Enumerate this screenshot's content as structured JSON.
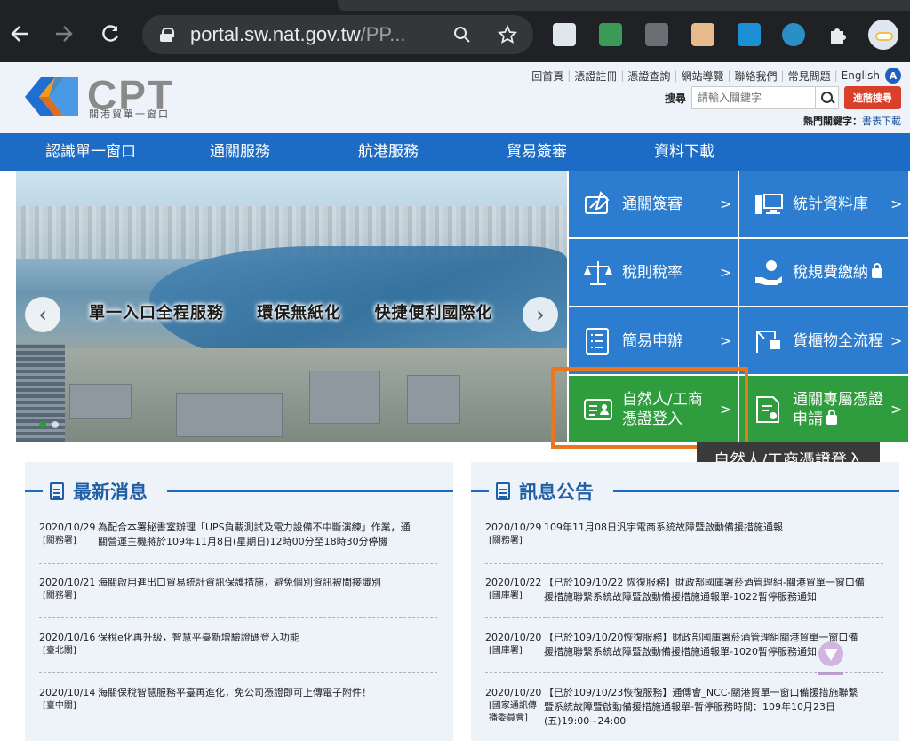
{
  "browser": {
    "url_main": "portal.sw.nat.gov.tw",
    "url_rest": "/PP..."
  },
  "header": {
    "logo_text": "CPT",
    "logo_sub": "關港貿單一窗口",
    "top_links": [
      "回首頁",
      "憑證註冊",
      "憑證查詢",
      "網站導覽",
      "聯絡我們",
      "常見問題",
      "English"
    ],
    "a_badge": "A",
    "search_label": "搜尋",
    "search_placeholder": "請輸入關鍵字",
    "advanced_search": "進階搜尋",
    "hot_label": "熱門關鍵字：",
    "hot_link": "書表下載"
  },
  "nav": [
    "認識單一窗口",
    "通關服務",
    "航港服務",
    "貿易簽審",
    "資料下載"
  ],
  "hero": {
    "slogans": [
      "單一入口全程服務",
      "環保無紙化",
      "快捷便利國際化"
    ],
    "prev": "‹",
    "next": "›"
  },
  "tiles": {
    "t1": "通關簽審",
    "t2": "統計資料庫",
    "t3": "稅則稅率",
    "t4": "稅規費繳納",
    "t5": "簡易申辦",
    "t6": "貨櫃物全流程",
    "t7a": "自然人/工商",
    "t7b": "憑證登入",
    "t8a": "通關專屬憑證",
    "t8b": "申請",
    "arrow": ">"
  },
  "tooltip": "自然人/工商憑證登入",
  "news": {
    "title": "最新消息",
    "items": [
      {
        "date": "2020/10/29",
        "cat": "[關務署]",
        "l1": "為配合本署秘書室辦理「UPS負載測試及電力設備不中斷演練」作業，通",
        "l2": "關營運主機將於109年11月8日(星期日)12時00分至18時30分停機"
      },
      {
        "date": "2020/10/21",
        "cat": "[關務署]",
        "l1": "海關啟用進出口貿易統計資訊保護措施，避免個別資訊被間接識別",
        "l2": ""
      },
      {
        "date": "2020/10/16",
        "cat": "[臺北關]",
        "l1": "保稅e化再升級，智慧平臺新增驗證碼登入功能",
        "l2": ""
      },
      {
        "date": "2020/10/14",
        "cat": "[臺中關]",
        "l1": "海關保稅智慧服務平臺再進化，免公司憑證即可上傳電子附件！",
        "l2": ""
      }
    ]
  },
  "notices": {
    "title": "訊息公告",
    "items": [
      {
        "date": "2020/10/29",
        "cat": "[關務署]",
        "l1": "109年11月08日汎宇電商系統故障暨啟動備援措施通報",
        "l2": ""
      },
      {
        "date": "2020/10/22",
        "cat": "[國庫署]",
        "l1": "【已於109/10/22 恢復服務】財政部國庫署菸酒管理組-關港貿單一窗口備",
        "l2": "援措施聯繫系統故障暨啟動備援措施通報單-1022暫停服務通知"
      },
      {
        "date": "2020/10/20",
        "cat": "[國庫署]",
        "l1": "【已於109/10/20恢復服務】財政部國庫署菸酒管理組關港貿單一窗口備",
        "l2": "援措施聯繫系統故障暨啟動備援措施通報單-1020暫停服務通知"
      },
      {
        "date": "2020/10/20",
        "cat": "[國家通訊傳播委員會]",
        "l1": "【已於109/10/23恢復服務】通傳會_NCC-關港貿單一窗口備援措施聯繫",
        "l2": "暨系統故障暨啟動備援措施通報單-暫停服務時間：109年10月23日",
        "l3": "(五)19:00~24:00"
      }
    ]
  },
  "colors": {
    "nav_blue": "#1c6bc4",
    "tile_blue": "#2c7dcf",
    "tile_green": "#2f9d3d",
    "highlight_orange": "#e8771d",
    "advanced_red": "#d9402a"
  }
}
